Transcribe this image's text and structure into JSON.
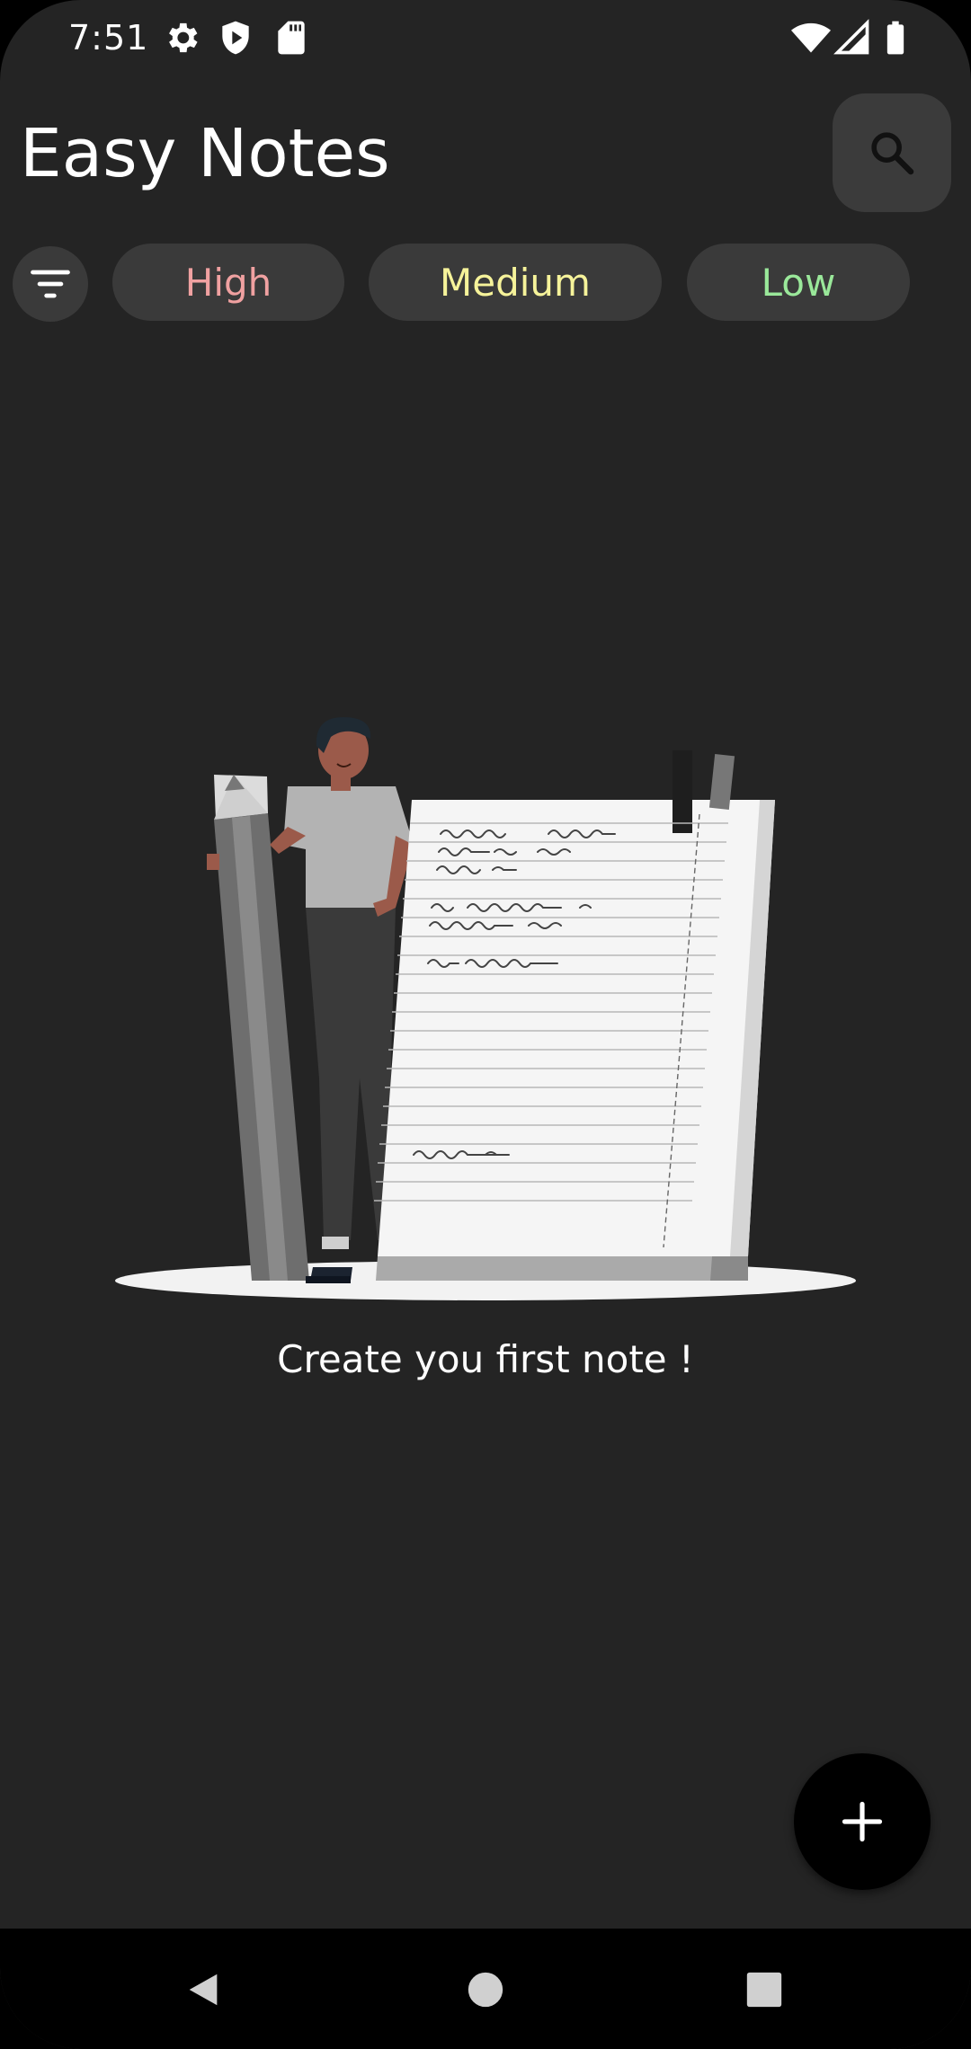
{
  "status_bar": {
    "time": "7:51",
    "left_icons": [
      "gear-icon",
      "shield-play-icon",
      "sd-card-icon"
    ],
    "right_icons": [
      "wifi-icon",
      "signal-icon",
      "battery-icon"
    ]
  },
  "header": {
    "title": "Easy Notes",
    "search_icon": "search-icon"
  },
  "filters": {
    "filter_icon": "filter-icon",
    "chips": [
      {
        "label": "High",
        "color": "#f0a1a1"
      },
      {
        "label": "Medium",
        "color": "#f6f39a"
      },
      {
        "label": "Low",
        "color": "#9ae89a"
      }
    ]
  },
  "empty_state": {
    "message": "Create you first note !"
  },
  "fab": {
    "icon": "plus-icon"
  },
  "nav_bar": {
    "buttons": [
      "back-icon",
      "home-icon",
      "recents-icon"
    ]
  },
  "colors": {
    "background": "#242424",
    "surface": "#3a3a3a"
  }
}
